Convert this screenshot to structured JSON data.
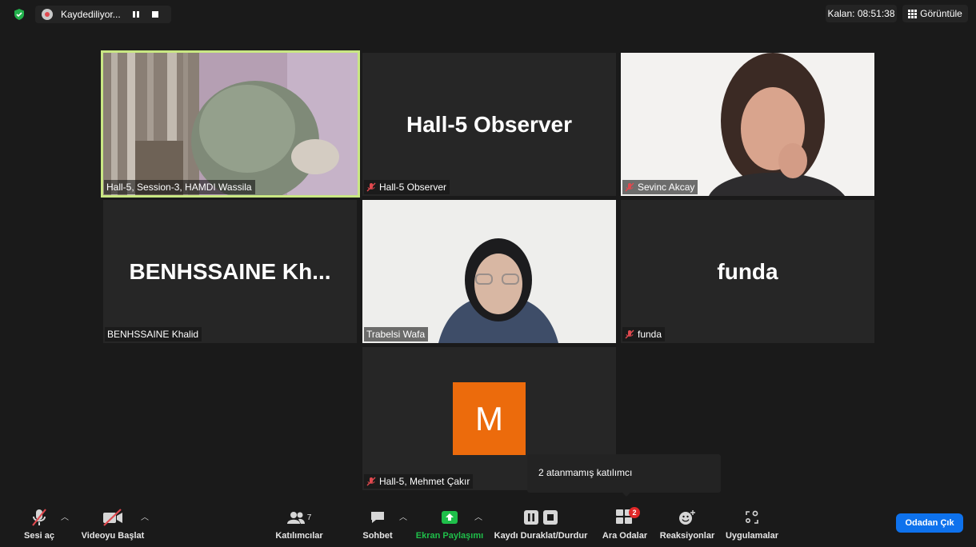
{
  "recording": {
    "status": "Kaydediliyor..."
  },
  "timer": "Kalan: 08:51:38",
  "view_label": "Görüntüle",
  "tiles": [
    {
      "name": "Hall-5, Session-3, HAMDI Wassila"
    },
    {
      "display_name": "Hall-5 Observer",
      "name": "Hall-5 Observer"
    },
    {
      "name": "Sevinc Akcay"
    },
    {
      "display_name": "BENHSSAINE  Kh...",
      "name": "BENHSSAINE Khalid"
    },
    {
      "name": "Trabelsi Wafa"
    },
    {
      "display_name": "funda",
      "name": "funda"
    },
    {
      "avatar_letter": "M",
      "name": "Hall-5, Mehmet Çakır"
    }
  ],
  "tooltip": "2 atanmamış katılımcı",
  "toolbar": {
    "audio": "Sesi aç",
    "video": "Videoyu Başlat",
    "participants": "Katılımcılar",
    "participants_count": "7",
    "chat": "Sohbet",
    "share": "Ekran Paylaşımı",
    "record": "Kaydı Duraklat/Durdur",
    "breakout": "Ara Odalar",
    "breakout_badge": "2",
    "reactions": "Reaksiyonlar",
    "apps": "Uygulamalar",
    "leave": "Odadan Çık"
  },
  "colors": {
    "accent_green": "#1fbf4a",
    "leave_blue": "#0e72ed",
    "avatar_orange": "#ec6b0c",
    "active_speaker": "#c9e783"
  }
}
